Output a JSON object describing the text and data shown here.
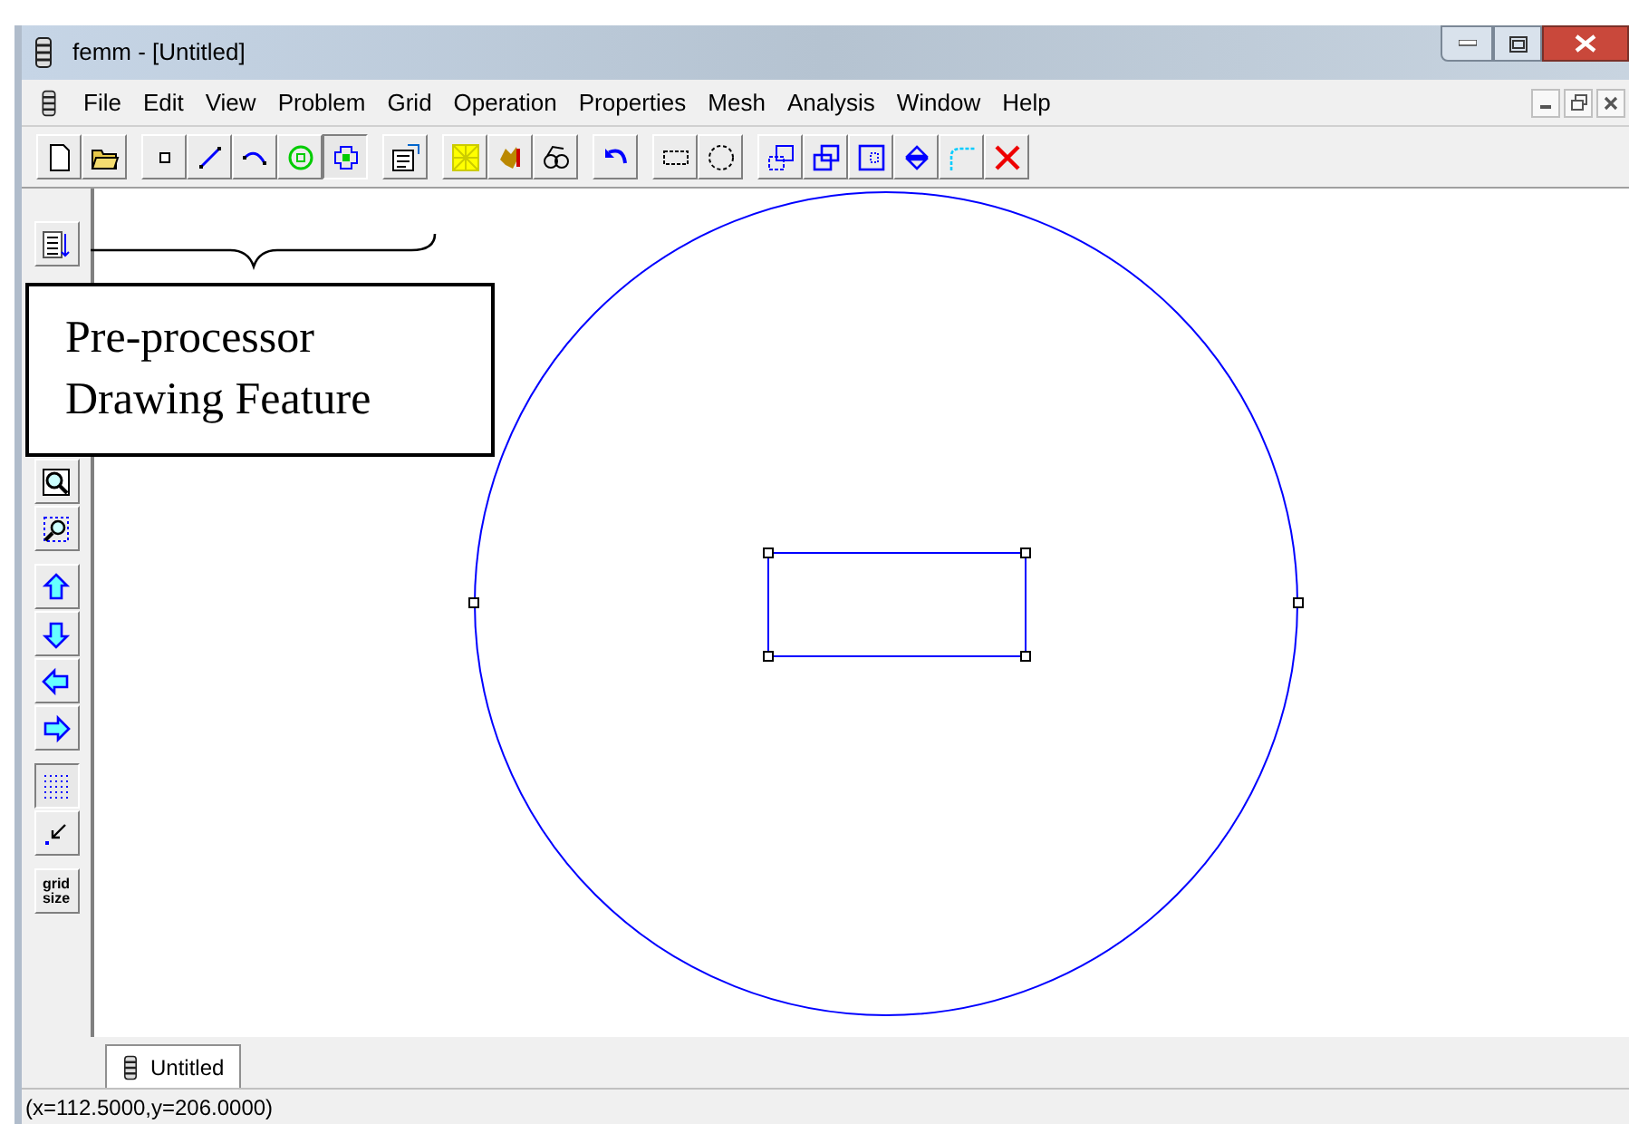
{
  "window": {
    "title": "femm - [Untitled]"
  },
  "menu": [
    "File",
    "Edit",
    "View",
    "Problem",
    "Grid",
    "Operation",
    "Properties",
    "Mesh",
    "Analysis",
    "Window",
    "Help"
  ],
  "toolbar": {
    "groups": [
      [
        {
          "selected": false
        },
        {
          "selected": false
        }
      ],
      [
        {
          "selected": false
        },
        {
          "selected": false
        },
        {
          "selected": false
        },
        {
          "selected": false
        },
        {
          "selected": true
        }
      ],
      [
        {
          "selected": false
        }
      ],
      [
        {
          "selected": false
        },
        {
          "selected": false
        },
        {
          "selected": false
        }
      ],
      [
        {
          "selected": false
        }
      ],
      [
        {
          "selected": false
        },
        {
          "selected": false
        }
      ],
      [
        {
          "selected": false
        },
        {
          "selected": false
        },
        {
          "selected": false
        },
        {
          "selected": false
        },
        {
          "selected": false
        },
        {
          "selected": false
        }
      ]
    ]
  },
  "side_toolbar": [
    {
      "kind": "icon",
      "selected": false
    },
    {
      "kind": "icon",
      "selected": false
    },
    {
      "kind": "icon",
      "selected": false
    },
    {
      "kind": "icon",
      "selected": false
    },
    {
      "kind": "icon",
      "selected": false
    },
    {
      "kind": "icon",
      "selected": false
    },
    {
      "kind": "icon",
      "selected": false
    },
    {
      "kind": "icon",
      "selected": true
    },
    {
      "kind": "icon",
      "selected": false
    },
    {
      "kind": "text",
      "label": "grid size",
      "selected": false
    }
  ],
  "annotation": {
    "lines": [
      "Pre-processor",
      "Drawing Feature"
    ]
  },
  "document_tabs": [
    {
      "label": "Untitled",
      "selected": true
    }
  ],
  "status_bar": "(x=112.5000,y=206.0000)"
}
